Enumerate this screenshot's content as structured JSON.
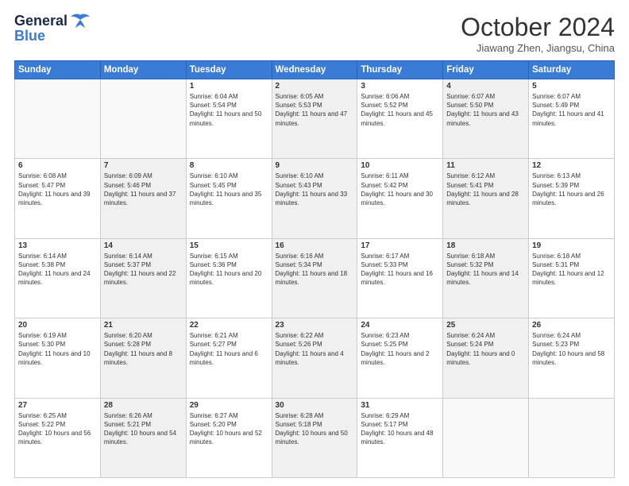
{
  "logo": {
    "general": "General",
    "blue": "Blue"
  },
  "header": {
    "month": "October 2024",
    "location": "Jiawang Zhen, Jiangsu, China"
  },
  "weekdays": [
    "Sunday",
    "Monday",
    "Tuesday",
    "Wednesday",
    "Thursday",
    "Friday",
    "Saturday"
  ],
  "weeks": [
    [
      {
        "day": "",
        "sunrise": "",
        "sunset": "",
        "daylight": "",
        "shaded": false,
        "empty": true
      },
      {
        "day": "",
        "sunrise": "",
        "sunset": "",
        "daylight": "",
        "shaded": false,
        "empty": true
      },
      {
        "day": "1",
        "sunrise": "Sunrise: 6:04 AM",
        "sunset": "Sunset: 5:54 PM",
        "daylight": "Daylight: 11 hours and 50 minutes.",
        "shaded": false,
        "empty": false
      },
      {
        "day": "2",
        "sunrise": "Sunrise: 6:05 AM",
        "sunset": "Sunset: 5:53 PM",
        "daylight": "Daylight: 11 hours and 47 minutes.",
        "shaded": true,
        "empty": false
      },
      {
        "day": "3",
        "sunrise": "Sunrise: 6:06 AM",
        "sunset": "Sunset: 5:52 PM",
        "daylight": "Daylight: 11 hours and 45 minutes.",
        "shaded": false,
        "empty": false
      },
      {
        "day": "4",
        "sunrise": "Sunrise: 6:07 AM",
        "sunset": "Sunset: 5:50 PM",
        "daylight": "Daylight: 11 hours and 43 minutes.",
        "shaded": true,
        "empty": false
      },
      {
        "day": "5",
        "sunrise": "Sunrise: 6:07 AM",
        "sunset": "Sunset: 5:49 PM",
        "daylight": "Daylight: 11 hours and 41 minutes.",
        "shaded": false,
        "empty": false
      }
    ],
    [
      {
        "day": "6",
        "sunrise": "Sunrise: 6:08 AM",
        "sunset": "Sunset: 5:47 PM",
        "daylight": "Daylight: 11 hours and 39 minutes.",
        "shaded": false,
        "empty": false
      },
      {
        "day": "7",
        "sunrise": "Sunrise: 6:09 AM",
        "sunset": "Sunset: 5:46 PM",
        "daylight": "Daylight: 11 hours and 37 minutes.",
        "shaded": true,
        "empty": false
      },
      {
        "day": "8",
        "sunrise": "Sunrise: 6:10 AM",
        "sunset": "Sunset: 5:45 PM",
        "daylight": "Daylight: 11 hours and 35 minutes.",
        "shaded": false,
        "empty": false
      },
      {
        "day": "9",
        "sunrise": "Sunrise: 6:10 AM",
        "sunset": "Sunset: 5:43 PM",
        "daylight": "Daylight: 11 hours and 33 minutes.",
        "shaded": true,
        "empty": false
      },
      {
        "day": "10",
        "sunrise": "Sunrise: 6:11 AM",
        "sunset": "Sunset: 5:42 PM",
        "daylight": "Daylight: 11 hours and 30 minutes.",
        "shaded": false,
        "empty": false
      },
      {
        "day": "11",
        "sunrise": "Sunrise: 6:12 AM",
        "sunset": "Sunset: 5:41 PM",
        "daylight": "Daylight: 11 hours and 28 minutes.",
        "shaded": true,
        "empty": false
      },
      {
        "day": "12",
        "sunrise": "Sunrise: 6:13 AM",
        "sunset": "Sunset: 5:39 PM",
        "daylight": "Daylight: 11 hours and 26 minutes.",
        "shaded": false,
        "empty": false
      }
    ],
    [
      {
        "day": "13",
        "sunrise": "Sunrise: 6:14 AM",
        "sunset": "Sunset: 5:38 PM",
        "daylight": "Daylight: 11 hours and 24 minutes.",
        "shaded": false,
        "empty": false
      },
      {
        "day": "14",
        "sunrise": "Sunrise: 6:14 AM",
        "sunset": "Sunset: 5:37 PM",
        "daylight": "Daylight: 11 hours and 22 minutes.",
        "shaded": true,
        "empty": false
      },
      {
        "day": "15",
        "sunrise": "Sunrise: 6:15 AM",
        "sunset": "Sunset: 5:36 PM",
        "daylight": "Daylight: 11 hours and 20 minutes.",
        "shaded": false,
        "empty": false
      },
      {
        "day": "16",
        "sunrise": "Sunrise: 6:16 AM",
        "sunset": "Sunset: 5:34 PM",
        "daylight": "Daylight: 11 hours and 18 minutes.",
        "shaded": true,
        "empty": false
      },
      {
        "day": "17",
        "sunrise": "Sunrise: 6:17 AM",
        "sunset": "Sunset: 5:33 PM",
        "daylight": "Daylight: 11 hours and 16 minutes.",
        "shaded": false,
        "empty": false
      },
      {
        "day": "18",
        "sunrise": "Sunrise: 6:18 AM",
        "sunset": "Sunset: 5:32 PM",
        "daylight": "Daylight: 11 hours and 14 minutes.",
        "shaded": true,
        "empty": false
      },
      {
        "day": "19",
        "sunrise": "Sunrise: 6:18 AM",
        "sunset": "Sunset: 5:31 PM",
        "daylight": "Daylight: 11 hours and 12 minutes.",
        "shaded": false,
        "empty": false
      }
    ],
    [
      {
        "day": "20",
        "sunrise": "Sunrise: 6:19 AM",
        "sunset": "Sunset: 5:30 PM",
        "daylight": "Daylight: 11 hours and 10 minutes.",
        "shaded": false,
        "empty": false
      },
      {
        "day": "21",
        "sunrise": "Sunrise: 6:20 AM",
        "sunset": "Sunset: 5:28 PM",
        "daylight": "Daylight: 11 hours and 8 minutes.",
        "shaded": true,
        "empty": false
      },
      {
        "day": "22",
        "sunrise": "Sunrise: 6:21 AM",
        "sunset": "Sunset: 5:27 PM",
        "daylight": "Daylight: 11 hours and 6 minutes.",
        "shaded": false,
        "empty": false
      },
      {
        "day": "23",
        "sunrise": "Sunrise: 6:22 AM",
        "sunset": "Sunset: 5:26 PM",
        "daylight": "Daylight: 11 hours and 4 minutes.",
        "shaded": true,
        "empty": false
      },
      {
        "day": "24",
        "sunrise": "Sunrise: 6:23 AM",
        "sunset": "Sunset: 5:25 PM",
        "daylight": "Daylight: 11 hours and 2 minutes.",
        "shaded": false,
        "empty": false
      },
      {
        "day": "25",
        "sunrise": "Sunrise: 6:24 AM",
        "sunset": "Sunset: 5:24 PM",
        "daylight": "Daylight: 11 hours and 0 minutes.",
        "shaded": true,
        "empty": false
      },
      {
        "day": "26",
        "sunrise": "Sunrise: 6:24 AM",
        "sunset": "Sunset: 5:23 PM",
        "daylight": "Daylight: 10 hours and 58 minutes.",
        "shaded": false,
        "empty": false
      }
    ],
    [
      {
        "day": "27",
        "sunrise": "Sunrise: 6:25 AM",
        "sunset": "Sunset: 5:22 PM",
        "daylight": "Daylight: 10 hours and 56 minutes.",
        "shaded": false,
        "empty": false
      },
      {
        "day": "28",
        "sunrise": "Sunrise: 6:26 AM",
        "sunset": "Sunset: 5:21 PM",
        "daylight": "Daylight: 10 hours and 54 minutes.",
        "shaded": true,
        "empty": false
      },
      {
        "day": "29",
        "sunrise": "Sunrise: 6:27 AM",
        "sunset": "Sunset: 5:20 PM",
        "daylight": "Daylight: 10 hours and 52 minutes.",
        "shaded": false,
        "empty": false
      },
      {
        "day": "30",
        "sunrise": "Sunrise: 6:28 AM",
        "sunset": "Sunset: 5:18 PM",
        "daylight": "Daylight: 10 hours and 50 minutes.",
        "shaded": true,
        "empty": false
      },
      {
        "day": "31",
        "sunrise": "Sunrise: 6:29 AM",
        "sunset": "Sunset: 5:17 PM",
        "daylight": "Daylight: 10 hours and 48 minutes.",
        "shaded": false,
        "empty": false
      },
      {
        "day": "",
        "sunrise": "",
        "sunset": "",
        "daylight": "",
        "shaded": false,
        "empty": true
      },
      {
        "day": "",
        "sunrise": "",
        "sunset": "",
        "daylight": "",
        "shaded": false,
        "empty": true
      }
    ]
  ]
}
